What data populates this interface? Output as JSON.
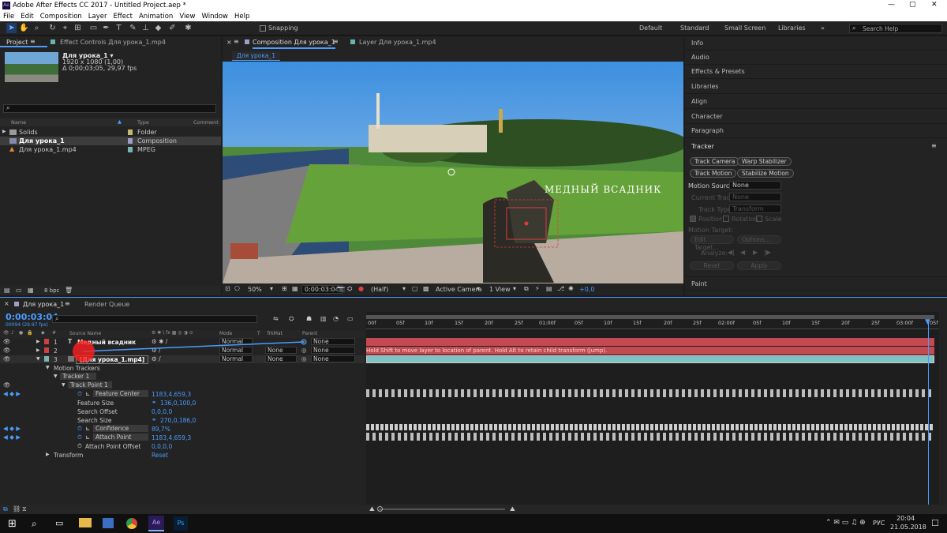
{
  "window": {
    "title": "Adobe After Effects CC 2017 - Untitled Project.aep *"
  },
  "menu": [
    "File",
    "Edit",
    "Composition",
    "Layer",
    "Effect",
    "Animation",
    "View",
    "Window",
    "Help"
  ],
  "toolbar": {
    "snapping": "Snapping",
    "workspaces": [
      "Default",
      "Standard",
      "Small Screen",
      "Libraries"
    ],
    "search": "Search Help"
  },
  "project": {
    "tab": "Project",
    "effect_tab": "Effect Controls Для урока_1.mp4",
    "comp_name": "Для урока_1 ▾",
    "comp_size": "1920 x 1080 (1,00)",
    "comp_duration": "Δ 0;00;03;05, 29,97 fps",
    "columns": {
      "name": "Name",
      "type": "Type",
      "comment": "Comment"
    },
    "items": [
      {
        "name": "Solids",
        "type": "Folder"
      },
      {
        "name": "Для урока_1",
        "type": "Composition"
      },
      {
        "name": "Для урока_1.mp4",
        "type": "MPEG"
      }
    ],
    "bpc": "8 bpc"
  },
  "viewer": {
    "comp_tab": "Composition Для урока_1",
    "layer_tab": "Layer Для урока_1.mp4",
    "breadcrumb": "Для урока_1",
    "overlay_text": "МЕДНЫЙ ВСАДНИК",
    "zoom": "50%",
    "timecode": "0:00:03:04",
    "resolution": "(Half)",
    "camera": "Active Camera",
    "views": "1 View",
    "exposure": "+0,0"
  },
  "side": {
    "items": [
      "Info",
      "Audio",
      "Effects & Presets",
      "Libraries",
      "Align",
      "Character",
      "Paragraph"
    ],
    "tracker_title": "Tracker",
    "buttons": [
      "Track Camera",
      "Warp Stabilizer",
      "Track Motion",
      "Stabilize Motion"
    ],
    "motion_source_label": "Motion Source:",
    "motion_source": "None",
    "current_track": "Current Track:",
    "current_track_val": "None",
    "track_type": "Track Type:",
    "track_type_val": "Transform",
    "position": "Position",
    "rotation": "Rotation",
    "scale": "Scale",
    "motion_target": "Motion Target:",
    "edit_target": "Edit Target...",
    "options": "Options...",
    "analyze": "Analyze:",
    "reset": "Reset",
    "apply": "Apply",
    "paint": "Paint"
  },
  "timeline": {
    "tab": "Для урока_1",
    "render_tab": "Render Queue",
    "timecode": "0:00:03:04",
    "frames": "00094 (29.97 fps)",
    "columns": {
      "source": "Source Name",
      "mode": "Mode",
      "t": "T",
      "trkmat": "TrkMat",
      "parent": "Parent"
    },
    "layers": [
      {
        "num": "1",
        "name": "Медный всадник",
        "mode": "Normal",
        "trkmat": "",
        "parent": "None"
      },
      {
        "num": "2",
        "name": "",
        "mode": "Normal",
        "trkmat": "None",
        "parent": "None"
      },
      {
        "num": "3",
        "name": "[Для урока_1.mp4]",
        "mode": "Normal",
        "trkmat": "None",
        "parent": "None"
      }
    ],
    "props": {
      "motion_trackers": "Motion Trackers",
      "tracker1": "Tracker 1",
      "track_point": "Track Point 1",
      "feature_center": "Feature Center",
      "feature_center_val": "1183,4,659,3",
      "feature_size": "Feature Size",
      "feature_size_val": "136,0,100,0",
      "search_offset": "Search Offset",
      "search_offset_val": "0,0,0,0",
      "search_size": "Search Size",
      "search_size_val": "270,0,186,0",
      "confidence": "Confidence",
      "confidence_val": "89,7%",
      "attach_point": "Attach Point",
      "attach_point_val": "1183,4,659,3",
      "attach_offset": "Attach Point Offset",
      "attach_offset_val": "0,0,0,0",
      "transform": "Transform",
      "transform_val": "Reset"
    },
    "ruler": [
      "00f",
      "05f",
      "10f",
      "15f",
      "20f",
      "25f",
      "01:00f",
      "05f",
      "10f",
      "15f",
      "20f",
      "25f",
      "02:00f",
      "05f",
      "10f",
      "15f",
      "20f",
      "25f",
      "03:00f",
      "05f"
    ],
    "hint": "Hold Shift to move layer to location of parent. Hold Alt to retain child transform (jump)."
  },
  "taskbar": {
    "lang": "РУС",
    "time": "20:04",
    "date": "21.05.2018"
  }
}
